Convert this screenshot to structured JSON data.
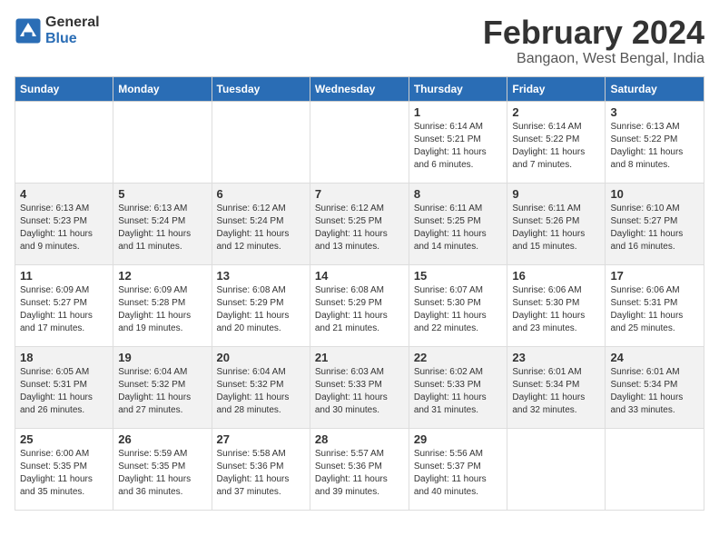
{
  "header": {
    "logo_general": "General",
    "logo_blue": "Blue",
    "month_title": "February 2024",
    "subtitle": "Bangaon, West Bengal, India"
  },
  "days_of_week": [
    "Sunday",
    "Monday",
    "Tuesday",
    "Wednesday",
    "Thursday",
    "Friday",
    "Saturday"
  ],
  "weeks": [
    [
      null,
      null,
      null,
      null,
      {
        "date": "1",
        "sunrise": "6:14 AM",
        "sunset": "5:21 PM",
        "daylight": "11 hours and 6 minutes."
      },
      {
        "date": "2",
        "sunrise": "6:14 AM",
        "sunset": "5:22 PM",
        "daylight": "11 hours and 7 minutes."
      },
      {
        "date": "3",
        "sunrise": "6:13 AM",
        "sunset": "5:22 PM",
        "daylight": "11 hours and 8 minutes."
      }
    ],
    [
      {
        "date": "4",
        "sunrise": "6:13 AM",
        "sunset": "5:23 PM",
        "daylight": "11 hours and 9 minutes."
      },
      {
        "date": "5",
        "sunrise": "6:13 AM",
        "sunset": "5:24 PM",
        "daylight": "11 hours and 11 minutes."
      },
      {
        "date": "6",
        "sunrise": "6:12 AM",
        "sunset": "5:24 PM",
        "daylight": "11 hours and 12 minutes."
      },
      {
        "date": "7",
        "sunrise": "6:12 AM",
        "sunset": "5:25 PM",
        "daylight": "11 hours and 13 minutes."
      },
      {
        "date": "8",
        "sunrise": "6:11 AM",
        "sunset": "5:25 PM",
        "daylight": "11 hours and 14 minutes."
      },
      {
        "date": "9",
        "sunrise": "6:11 AM",
        "sunset": "5:26 PM",
        "daylight": "11 hours and 15 minutes."
      },
      {
        "date": "10",
        "sunrise": "6:10 AM",
        "sunset": "5:27 PM",
        "daylight": "11 hours and 16 minutes."
      }
    ],
    [
      {
        "date": "11",
        "sunrise": "6:09 AM",
        "sunset": "5:27 PM",
        "daylight": "11 hours and 17 minutes."
      },
      {
        "date": "12",
        "sunrise": "6:09 AM",
        "sunset": "5:28 PM",
        "daylight": "11 hours and 19 minutes."
      },
      {
        "date": "13",
        "sunrise": "6:08 AM",
        "sunset": "5:29 PM",
        "daylight": "11 hours and 20 minutes."
      },
      {
        "date": "14",
        "sunrise": "6:08 AM",
        "sunset": "5:29 PM",
        "daylight": "11 hours and 21 minutes."
      },
      {
        "date": "15",
        "sunrise": "6:07 AM",
        "sunset": "5:30 PM",
        "daylight": "11 hours and 22 minutes."
      },
      {
        "date": "16",
        "sunrise": "6:06 AM",
        "sunset": "5:30 PM",
        "daylight": "11 hours and 23 minutes."
      },
      {
        "date": "17",
        "sunrise": "6:06 AM",
        "sunset": "5:31 PM",
        "daylight": "11 hours and 25 minutes."
      }
    ],
    [
      {
        "date": "18",
        "sunrise": "6:05 AM",
        "sunset": "5:31 PM",
        "daylight": "11 hours and 26 minutes."
      },
      {
        "date": "19",
        "sunrise": "6:04 AM",
        "sunset": "5:32 PM",
        "daylight": "11 hours and 27 minutes."
      },
      {
        "date": "20",
        "sunrise": "6:04 AM",
        "sunset": "5:32 PM",
        "daylight": "11 hours and 28 minutes."
      },
      {
        "date": "21",
        "sunrise": "6:03 AM",
        "sunset": "5:33 PM",
        "daylight": "11 hours and 30 minutes."
      },
      {
        "date": "22",
        "sunrise": "6:02 AM",
        "sunset": "5:33 PM",
        "daylight": "11 hours and 31 minutes."
      },
      {
        "date": "23",
        "sunrise": "6:01 AM",
        "sunset": "5:34 PM",
        "daylight": "11 hours and 32 minutes."
      },
      {
        "date": "24",
        "sunrise": "6:01 AM",
        "sunset": "5:34 PM",
        "daylight": "11 hours and 33 minutes."
      }
    ],
    [
      {
        "date": "25",
        "sunrise": "6:00 AM",
        "sunset": "5:35 PM",
        "daylight": "11 hours and 35 minutes."
      },
      {
        "date": "26",
        "sunrise": "5:59 AM",
        "sunset": "5:35 PM",
        "daylight": "11 hours and 36 minutes."
      },
      {
        "date": "27",
        "sunrise": "5:58 AM",
        "sunset": "5:36 PM",
        "daylight": "11 hours and 37 minutes."
      },
      {
        "date": "28",
        "sunrise": "5:57 AM",
        "sunset": "5:36 PM",
        "daylight": "11 hours and 39 minutes."
      },
      {
        "date": "29",
        "sunrise": "5:56 AM",
        "sunset": "5:37 PM",
        "daylight": "11 hours and 40 minutes."
      },
      null,
      null
    ]
  ],
  "labels": {
    "sunrise": "Sunrise:",
    "sunset": "Sunset:",
    "daylight": "Daylight:"
  }
}
